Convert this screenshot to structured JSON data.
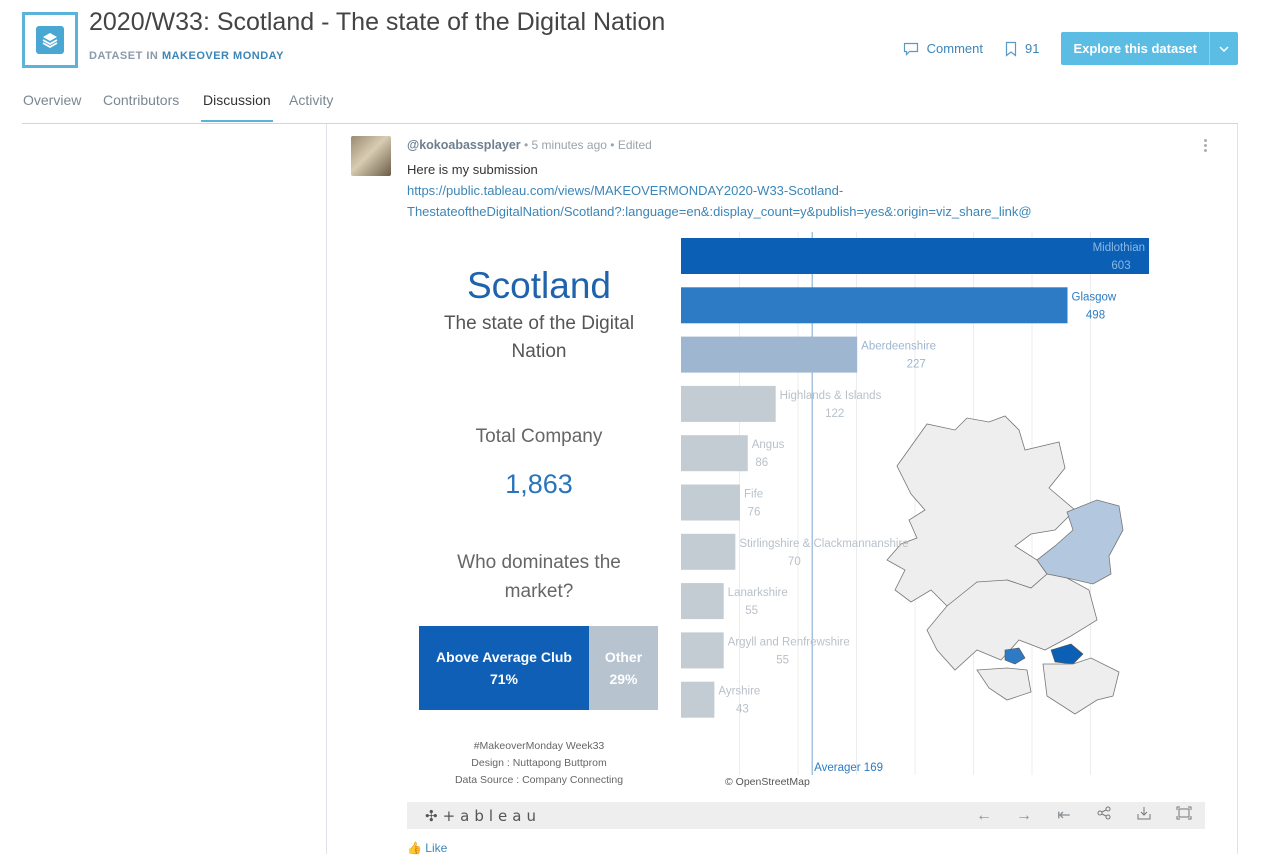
{
  "header": {
    "title": "2020/W33: Scotland - The state of the Digital Nation",
    "subtitle_prefix": "DATASET IN ",
    "subtitle_link": "MAKEOVER MONDAY",
    "comment_label": "Comment",
    "bookmark_count": "91",
    "explore_label": "Explore this dataset"
  },
  "tabs": [
    {
      "label": "Overview"
    },
    {
      "label": "Contributors"
    },
    {
      "label": "Discussion"
    },
    {
      "label": "Activity"
    }
  ],
  "post": {
    "user": "@kokoabassplayer",
    "time": "5 minutes ago",
    "edited": "Edited",
    "message": "Here is my submission",
    "url_line1": "https://public.tableau.com/views/MAKEOVERMONDAY2020-W33-Scotland-",
    "url_line2": "ThestateoftheDigitalNation/Scotland?:language=en&:display_count=y&publish=yes&:origin=viz_share_link@",
    "like_label": "Like"
  },
  "viz": {
    "title": "Scotland",
    "subtitle": "The state of the Digital Nation",
    "total_label": "Total Company",
    "total_value": "1,863",
    "question": "Who dominates the market?",
    "above_label": "Above Average Club",
    "above_pct": "71%",
    "other_label": "Other",
    "other_pct": "29%",
    "credit1": "#MakeoverMonday Week33",
    "credit2": "Design : Nuttapong Buttprom",
    "credit3": "Data Source : Company Connecting",
    "average_label": "Averager 169",
    "map_credit": "© OpenStreetMap",
    "toolbar_logo": "+ableau"
  },
  "chart_data": {
    "type": "bar",
    "orientation": "horizontal",
    "categories": [
      "Midlothian",
      "Glasgow",
      "Aberdeenshire",
      "Highlands & Islands",
      "Angus",
      "Fife",
      "Stirlingshire & Clackmannanshire",
      "Lanarkshire",
      "Argyll and Renfrewshire",
      "Ayrshire"
    ],
    "values": [
      603,
      498,
      227,
      122,
      86,
      76,
      70,
      55,
      55,
      43
    ],
    "colors": [
      "#0b5fb5",
      "#2d7bc4",
      "#9fb6d0",
      "#c3cbd3",
      "#c3cbd3",
      "#c3cbd3",
      "#c3cbd3",
      "#c3cbd3",
      "#c3cbd3",
      "#c3cbd3"
    ],
    "label_colors": [
      "#8ab8e6",
      "#2d7bc4",
      "#9fb6d0",
      "#b9c1c9",
      "#b9c1c9",
      "#b9c1c9",
      "#b9c1c9",
      "#b9c1c9",
      "#b9c1c9",
      "#b9c1c9"
    ],
    "average": 169,
    "xlim": [
      0,
      603
    ],
    "grid": true
  }
}
